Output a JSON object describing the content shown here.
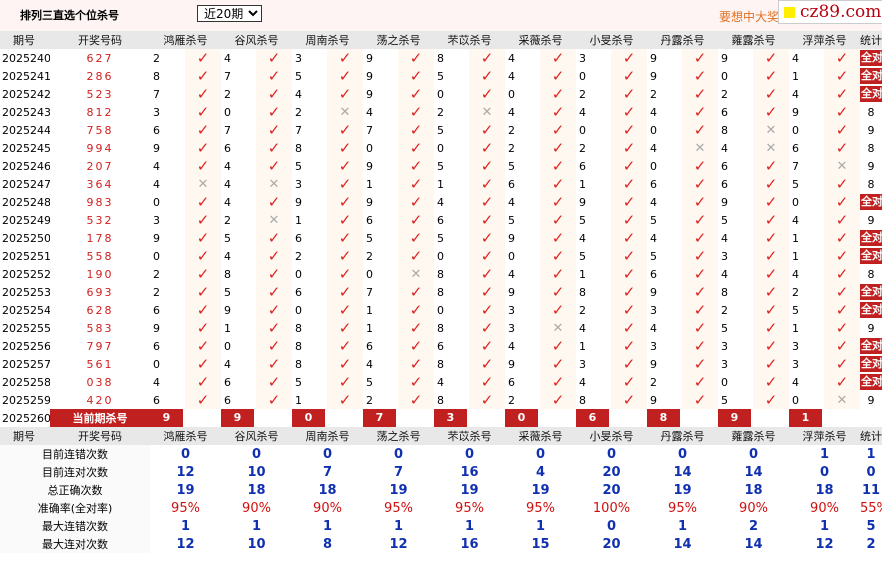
{
  "page": {
    "title": "排列三直选个位杀号",
    "period_selected": "近20期",
    "promo_text": "要想中大奖",
    "logo_text": "cz89.com"
  },
  "header": {
    "issue": "期号",
    "draw": "开奖号码",
    "killers": [
      "鸿雁杀号",
      "谷风杀号",
      "周南杀号",
      "荡之杀号",
      "芣苡杀号",
      "采薇杀号",
      "小旻杀号",
      "丹露杀号",
      "蕹露杀号",
      "浮萍杀号"
    ],
    "total": "统计"
  },
  "rows": [
    {
      "issue": "2025240",
      "draw": "627",
      "kills": [
        2,
        4,
        3,
        9,
        8,
        4,
        3,
        9,
        9,
        4
      ],
      "hits": [
        1,
        1,
        1,
        1,
        1,
        1,
        1,
        1,
        1,
        1
      ],
      "total": "全对"
    },
    {
      "issue": "2025241",
      "draw": "286",
      "kills": [
        8,
        7,
        5,
        9,
        5,
        4,
        0,
        9,
        0,
        1
      ],
      "hits": [
        1,
        1,
        1,
        1,
        1,
        1,
        1,
        1,
        1,
        1
      ],
      "total": "全对"
    },
    {
      "issue": "2025242",
      "draw": "523",
      "kills": [
        7,
        2,
        4,
        9,
        0,
        0,
        2,
        2,
        2,
        4
      ],
      "hits": [
        1,
        1,
        1,
        1,
        1,
        1,
        1,
        1,
        1,
        1
      ],
      "total": "全对"
    },
    {
      "issue": "2025243",
      "draw": "812",
      "kills": [
        3,
        0,
        2,
        4,
        2,
        4,
        4,
        4,
        6,
        9
      ],
      "hits": [
        1,
        1,
        0,
        1,
        0,
        1,
        1,
        1,
        1,
        1
      ],
      "total": "8"
    },
    {
      "issue": "2025244",
      "draw": "758",
      "kills": [
        6,
        7,
        7,
        7,
        5,
        2,
        0,
        0,
        8,
        0
      ],
      "hits": [
        1,
        1,
        1,
        1,
        1,
        1,
        1,
        1,
        0,
        1
      ],
      "total": "9"
    },
    {
      "issue": "2025245",
      "draw": "994",
      "kills": [
        9,
        6,
        8,
        0,
        0,
        2,
        2,
        4,
        4,
        6
      ],
      "hits": [
        1,
        1,
        1,
        1,
        1,
        1,
        1,
        0,
        0,
        1
      ],
      "total": "8"
    },
    {
      "issue": "2025246",
      "draw": "207",
      "kills": [
        4,
        4,
        5,
        9,
        5,
        5,
        6,
        0,
        6,
        7
      ],
      "hits": [
        1,
        1,
        1,
        1,
        1,
        1,
        1,
        1,
        1,
        0
      ],
      "total": "9"
    },
    {
      "issue": "2025247",
      "draw": "364",
      "kills": [
        4,
        4,
        3,
        1,
        1,
        6,
        1,
        6,
        6,
        5
      ],
      "hits": [
        0,
        0,
        1,
        1,
        1,
        1,
        1,
        1,
        1,
        1
      ],
      "total": "8"
    },
    {
      "issue": "2025248",
      "draw": "983",
      "kills": [
        0,
        4,
        9,
        9,
        4,
        4,
        9,
        4,
        9,
        0
      ],
      "hits": [
        1,
        1,
        1,
        1,
        1,
        1,
        1,
        1,
        1,
        1
      ],
      "total": "全对"
    },
    {
      "issue": "2025249",
      "draw": "532",
      "kills": [
        3,
        2,
        1,
        6,
        6,
        5,
        5,
        5,
        5,
        4
      ],
      "hits": [
        1,
        0,
        1,
        1,
        1,
        1,
        1,
        1,
        1,
        1
      ],
      "total": "9"
    },
    {
      "issue": "2025250",
      "draw": "178",
      "kills": [
        9,
        5,
        6,
        5,
        5,
        9,
        4,
        4,
        4,
        1
      ],
      "hits": [
        1,
        1,
        1,
        1,
        1,
        1,
        1,
        1,
        1,
        1
      ],
      "total": "全对"
    },
    {
      "issue": "2025251",
      "draw": "558",
      "kills": [
        0,
        4,
        2,
        2,
        0,
        0,
        5,
        5,
        3,
        1
      ],
      "hits": [
        1,
        1,
        1,
        1,
        1,
        1,
        1,
        1,
        1,
        1
      ],
      "total": "全对"
    },
    {
      "issue": "2025252",
      "draw": "190",
      "kills": [
        2,
        8,
        0,
        0,
        8,
        4,
        1,
        6,
        4,
        4
      ],
      "hits": [
        1,
        1,
        1,
        0,
        1,
        1,
        1,
        1,
        1,
        1
      ],
      "total": "8"
    },
    {
      "issue": "2025253",
      "draw": "693",
      "kills": [
        2,
        5,
        6,
        7,
        8,
        9,
        8,
        9,
        8,
        2
      ],
      "hits": [
        1,
        1,
        1,
        1,
        1,
        1,
        1,
        1,
        1,
        1
      ],
      "total": "全对"
    },
    {
      "issue": "2025254",
      "draw": "628",
      "kills": [
        6,
        9,
        0,
        1,
        0,
        3,
        2,
        3,
        2,
        5
      ],
      "hits": [
        1,
        1,
        1,
        1,
        1,
        1,
        1,
        1,
        1,
        1
      ],
      "total": "全对"
    },
    {
      "issue": "2025255",
      "draw": "583",
      "kills": [
        9,
        1,
        8,
        1,
        8,
        3,
        4,
        4,
        5,
        1
      ],
      "hits": [
        1,
        1,
        1,
        1,
        1,
        0,
        1,
        1,
        1,
        1
      ],
      "total": "9"
    },
    {
      "issue": "2025256",
      "draw": "797",
      "kills": [
        6,
        0,
        8,
        6,
        6,
        4,
        1,
        3,
        3,
        3
      ],
      "hits": [
        1,
        1,
        1,
        1,
        1,
        1,
        1,
        1,
        1,
        1
      ],
      "total": "全对"
    },
    {
      "issue": "2025257",
      "draw": "561",
      "kills": [
        0,
        4,
        8,
        4,
        8,
        9,
        3,
        9,
        3,
        3
      ],
      "hits": [
        1,
        1,
        1,
        1,
        1,
        1,
        1,
        1,
        1,
        1
      ],
      "total": "全对"
    },
    {
      "issue": "2025258",
      "draw": "038",
      "kills": [
        4,
        6,
        5,
        5,
        4,
        6,
        4,
        2,
        0,
        4
      ],
      "hits": [
        1,
        1,
        1,
        1,
        1,
        1,
        1,
        1,
        1,
        1
      ],
      "total": "全对"
    },
    {
      "issue": "2025259",
      "draw": "420",
      "kills": [
        6,
        6,
        1,
        2,
        8,
        2,
        8,
        9,
        5,
        0
      ],
      "hits": [
        1,
        1,
        1,
        1,
        1,
        1,
        1,
        1,
        1,
        0
      ],
      "total": "9"
    }
  ],
  "current": {
    "issue": "2025260",
    "label": "当前期杀号",
    "kills": [
      9,
      9,
      0,
      7,
      3,
      0,
      6,
      8,
      9,
      1
    ]
  },
  "stats": [
    {
      "label": "目前连错次数",
      "values": [
        "0",
        "0",
        "0",
        "0",
        "0",
        "0",
        "0",
        "0",
        "0",
        "1"
      ],
      "total": "1"
    },
    {
      "label": "目前连对次数",
      "values": [
        "12",
        "10",
        "7",
        "7",
        "16",
        "4",
        "20",
        "14",
        "14",
        "0"
      ],
      "total": "0"
    },
    {
      "label": "总正确次数",
      "values": [
        "19",
        "18",
        "18",
        "19",
        "19",
        "19",
        "20",
        "19",
        "18",
        "18"
      ],
      "total": "11"
    },
    {
      "label": "准确率(全对率)",
      "values": [
        "95%",
        "90%",
        "90%",
        "95%",
        "95%",
        "95%",
        "100%",
        "95%",
        "90%",
        "90%"
      ],
      "total": "55%"
    },
    {
      "label": "最大连错次数",
      "values": [
        "1",
        "1",
        "1",
        "1",
        "1",
        "1",
        "0",
        "1",
        "2",
        "1"
      ],
      "total": "5"
    },
    {
      "label": "最大连对次数",
      "values": [
        "12",
        "10",
        "8",
        "12",
        "16",
        "15",
        "20",
        "14",
        "14",
        "12"
      ],
      "total": "2"
    }
  ],
  "icons": {
    "hit": "check-mark-icon",
    "miss": "cross-mark-icon"
  },
  "colors": {
    "hit": "#dd2222",
    "miss": "#aaaaaa",
    "accent": "#c02020",
    "stat_value": "#1030b0"
  }
}
